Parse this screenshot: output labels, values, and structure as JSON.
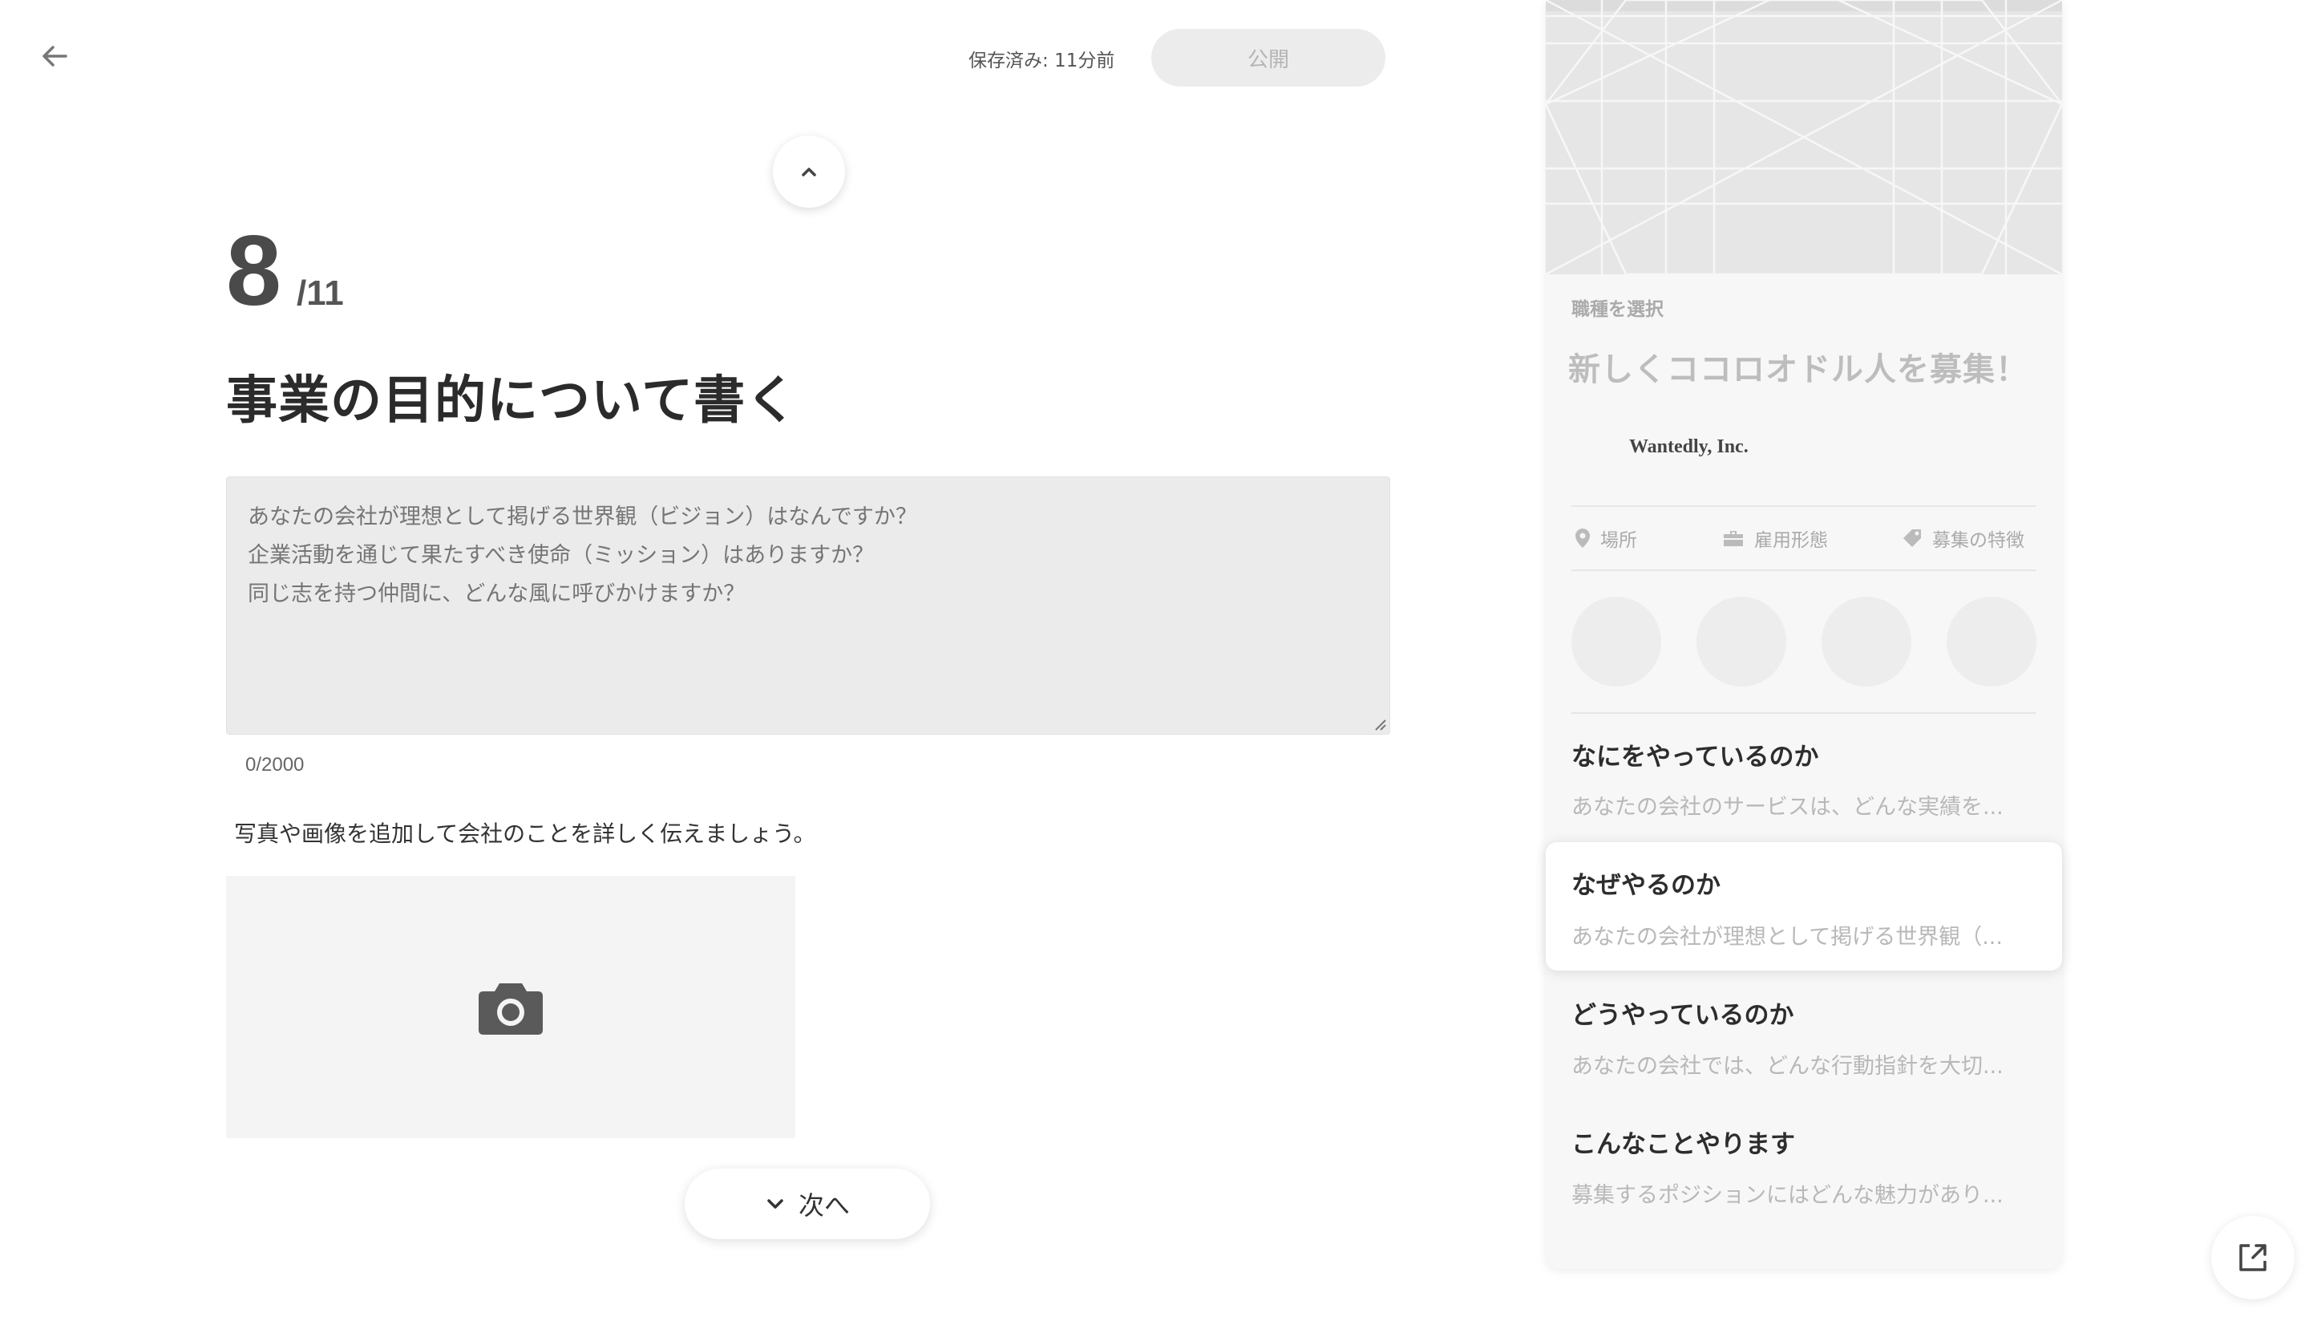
{
  "header": {
    "save_status": "保存済み: 11分前",
    "publish_label": "公開"
  },
  "step": {
    "current": "8",
    "total": "/11"
  },
  "title": "事業の目的について書く",
  "editor": {
    "placeholder": "あなたの会社が理想として掲げる世界観（ビジョン）はなんですか？\n企業活動を通じて果たすべき使命（ミッション）はありますか？\n同じ志を持つ仲間に、どんな風に呼びかけますか？",
    "char_count": "0/2000"
  },
  "photo": {
    "hint": "写真や画像を追加して会社のことを詳しく伝えましょう。"
  },
  "next_label": "次へ",
  "preview": {
    "occupation": "職種を選択",
    "headline": "新しくココロオドル人を募集！",
    "company": "Wantedly, Inc.",
    "meta": {
      "location": "場所",
      "employment": "雇用形態",
      "features": "募集の特徴"
    },
    "sections": [
      {
        "title": "なにをやっているのか",
        "text": "あなたの会社のサービスは、どんな実績を..."
      },
      {
        "title": "なぜやるのか",
        "text": "あなたの会社が理想として掲げる世界観（..."
      },
      {
        "title": "どうやっているのか",
        "text": "あなたの会社では、どんな行動指針を大切..."
      },
      {
        "title": "こんなことやります",
        "text": "募集するポジションにはどんな魅力があり..."
      }
    ]
  },
  "icons": {
    "back": "arrow-left-icon",
    "up": "chevron-up-icon",
    "down": "chevron-down-icon",
    "camera": "camera-icon",
    "location": "map-pin-icon",
    "employment": "briefcase-icon",
    "features": "tag-icon",
    "external": "external-link-icon"
  },
  "colors": {
    "text_primary": "#2b2b2b",
    "publish_disabled_bg": "#ececec",
    "placeholder": "#888888"
  }
}
